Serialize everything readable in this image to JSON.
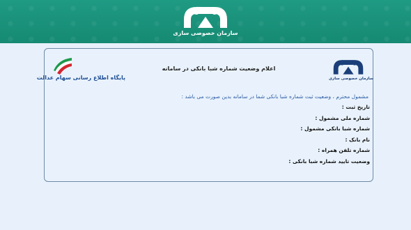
{
  "header": {
    "org_name": "سازمان خصوصی سازی",
    "logo_icon": "privatization-org-logo-icon"
  },
  "panel": {
    "brand_text": "پایگاه اطلاع رسانی سهام عدالت",
    "brand_icon": "iran-flag-wave-icon",
    "title": "اعلام وضعیت شماره شبا بانکی در سامانه",
    "org_logo_icon": "privatization-org-logo-icon",
    "org_logo_label": "سازمان خصوصی سازی",
    "message": "مشمول محترم ، وضعیت ثبت شماره شبا بانکی شما در سامانه بدین صورت می باشد :",
    "fields": [
      {
        "label": "تاریخ ثبت :"
      },
      {
        "label": "شماره ملی مشمول :"
      },
      {
        "label": "شماره شبا بانکی مشمول :"
      },
      {
        "label": "نام بانک :"
      },
      {
        "label": "شماره تلفن همراه :"
      },
      {
        "label": "وضعیت تایید شماره شبا بانکی :"
      }
    ]
  },
  "colors": {
    "header_bg": "#168a73",
    "page_bg": "#e8f1fb",
    "brand_blue": "#1f4f96",
    "logo_navy": "#1b3f7a"
  }
}
